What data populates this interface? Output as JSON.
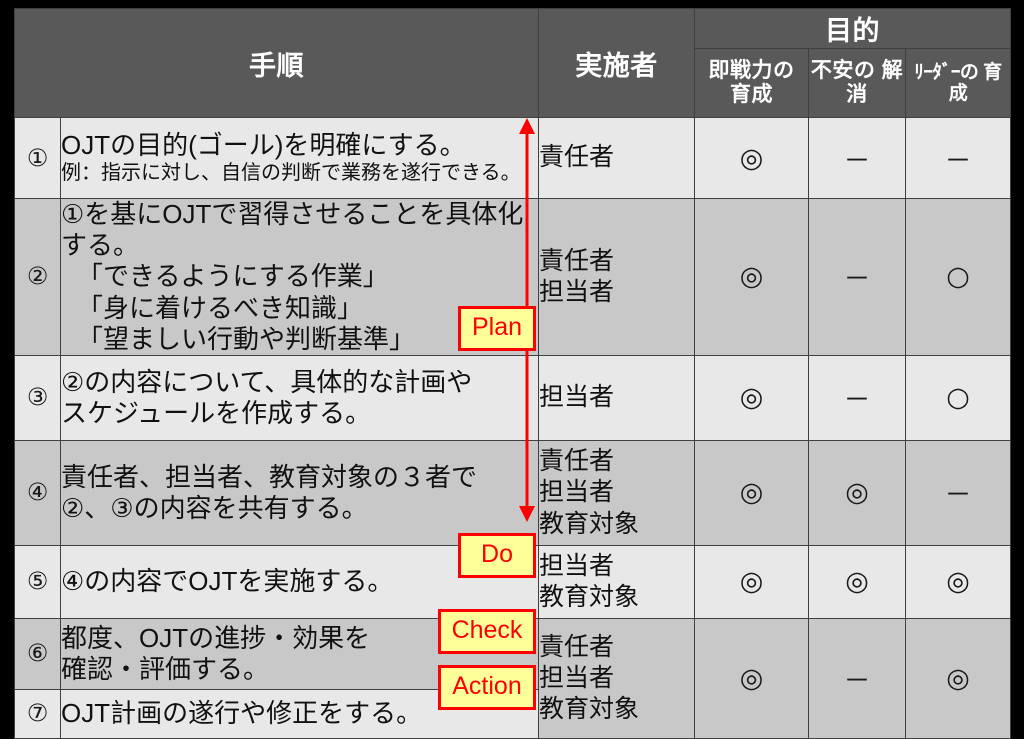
{
  "table": {
    "headers": {
      "step": "手順",
      "actor": "実施者",
      "purpose_group": "目的",
      "purpose_sub": [
        "即戦力の\n育成",
        "不安の\n解消",
        "ﾘｰﾀﾞｰの\n育成"
      ],
      "purpose_sub_flat": [
        "即戦力の育成",
        "不安の解消",
        "ﾘｰﾀﾞｰの育成"
      ]
    },
    "rows": [
      {
        "num": "①",
        "step_lines": [
          "OJTの目的(ゴール)を明確にする。"
        ],
        "step_note": "例：指示に対し、自信の判断で業務を遂行できる。",
        "actor_lines": [
          "責任者"
        ],
        "marks": [
          "◎",
          "－",
          "－"
        ]
      },
      {
        "num": "②",
        "step_lines": [
          "①を基にOJTで習得させることを具体化する。",
          "「できるようにする作業」",
          "「身に着けるべき知識」",
          "「望ましい行動や判断基準」"
        ],
        "step_note": "",
        "actor_lines": [
          "責任者",
          "担当者"
        ],
        "marks": [
          "◎",
          "－",
          "○"
        ]
      },
      {
        "num": "③",
        "step_lines": [
          "②の内容について、具体的な計画や",
          "スケジュールを作成する。"
        ],
        "step_note": "",
        "actor_lines": [
          "担当者"
        ],
        "marks": [
          "◎",
          "－",
          "○"
        ]
      },
      {
        "num": "④",
        "step_lines": [
          "責任者、担当者、教育対象の３者で",
          "②、③の内容を共有する。"
        ],
        "step_note": "",
        "actor_lines": [
          "責任者",
          "担当者",
          "教育対象"
        ],
        "marks": [
          "◎",
          "◎",
          "－"
        ]
      },
      {
        "num": "⑤",
        "step_lines": [
          "④の内容でOJTを実施する。"
        ],
        "step_note": "",
        "actor_lines": [
          "担当者",
          "教育対象"
        ],
        "marks": [
          "◎",
          "◎",
          "◎"
        ]
      },
      {
        "num": "⑥",
        "step_lines": [
          "都度、OJTの進捗・効果を",
          "確認・評価する。"
        ],
        "step_note": "",
        "actor_lines": [
          "責任者",
          "担当者",
          "教育対象"
        ],
        "marks": [
          "◎",
          "－",
          "◎"
        ]
      },
      {
        "num": "⑦",
        "step_lines": [
          "OJT計画の遂行や修正をする。"
        ],
        "step_note": "",
        "actor_lines": [],
        "marks": []
      }
    ]
  },
  "badges": {
    "plan": "Plan",
    "do": "Do",
    "check": "Check",
    "action": "Action"
  },
  "colors": {
    "header_bg": "#595959",
    "header_text": "#ffffff",
    "row_light": "#e8e8e8",
    "row_dark": "#c8c8c8",
    "badge_bg": "#ffff99",
    "badge_border": "#ff0000",
    "badge_text": "#ff0000",
    "arrow": "#ff0000",
    "page_bg": "#000000",
    "grid_line": "#404040"
  }
}
